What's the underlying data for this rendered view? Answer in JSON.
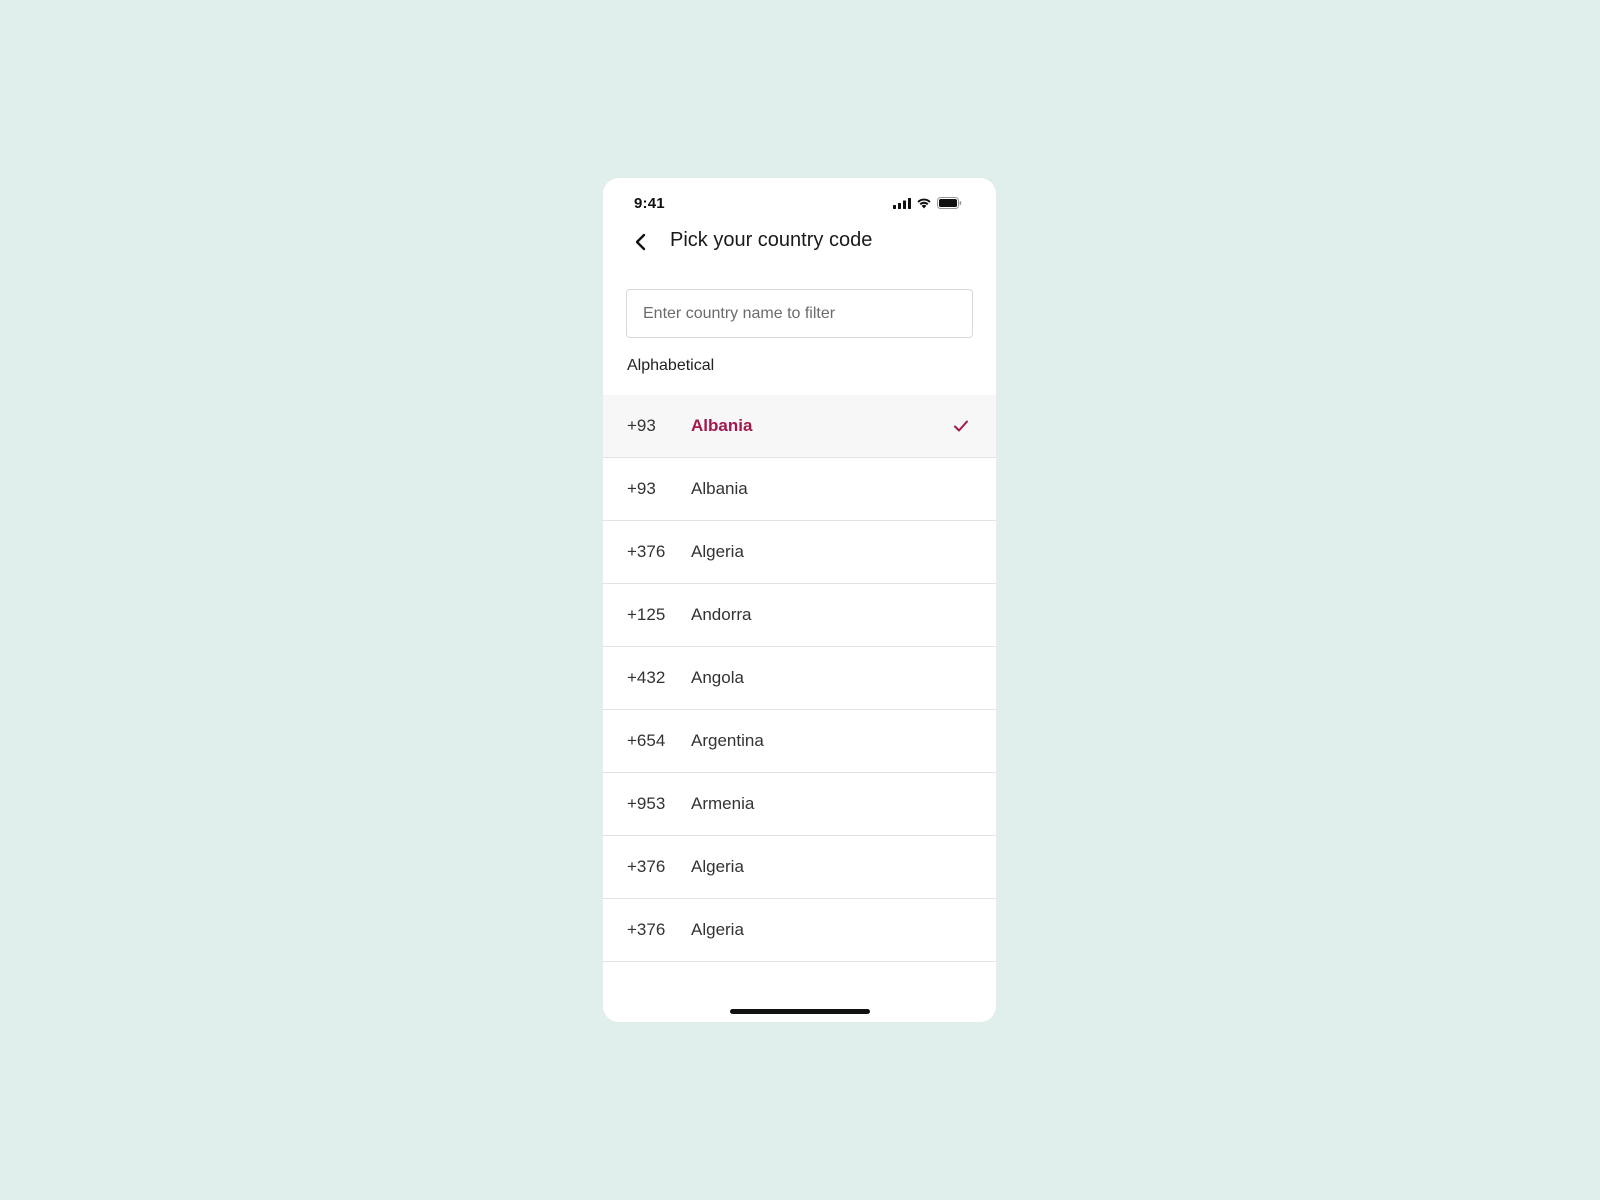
{
  "status_bar": {
    "time": "9:41"
  },
  "header": {
    "title": "Pick your country code",
    "back_icon": "chevron-left-icon"
  },
  "search": {
    "placeholder": "Enter country name to filter",
    "value": ""
  },
  "section_label": "Alphabetical",
  "countries": [
    {
      "code": "+93",
      "name": "Albania",
      "selected": true
    },
    {
      "code": "+93",
      "name": "Albania",
      "selected": false
    },
    {
      "code": "+376",
      "name": "Algeria",
      "selected": false
    },
    {
      "code": "+125",
      "name": "Andorra",
      "selected": false
    },
    {
      "code": "+432",
      "name": "Angola",
      "selected": false
    },
    {
      "code": "+654",
      "name": "Argentina",
      "selected": false
    },
    {
      "code": "+953",
      "name": "Armenia",
      "selected": false
    },
    {
      "code": "+376",
      "name": "Algeria",
      "selected": false
    },
    {
      "code": "+376",
      "name": "Algeria",
      "selected": false
    }
  ],
  "colors": {
    "background": "#e0efeb",
    "accent": "#a3184f",
    "selected_row": "#f7f7f7"
  }
}
